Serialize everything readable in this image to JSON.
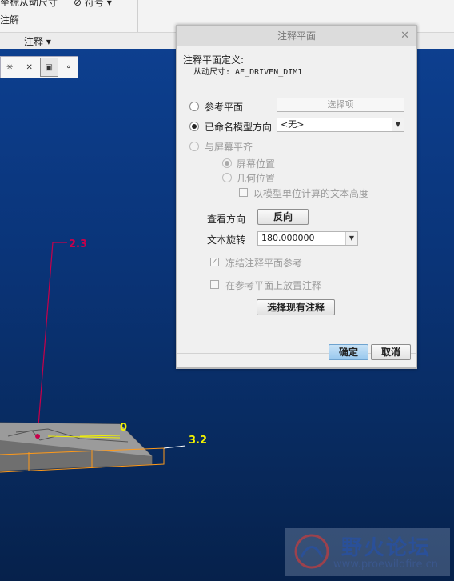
{
  "ribbon": {
    "row1_text": "坐标从动尺寸",
    "symbol_label": "符号",
    "row2_text": "注解",
    "group_label": "注释"
  },
  "dialog": {
    "title": "注释平面",
    "definition_label": "注释平面定义:",
    "driven_dim_label": "从动尺寸: AE_DRIVEN_DIM1",
    "ref_plane_label": "参考平面",
    "ref_plane_placeholder": "选择项",
    "named_view_label": "已命名模型方向",
    "named_view_value": "<无>",
    "align_screen_label": "与屏幕平齐",
    "screen_pos_label": "屏幕位置",
    "geom_pos_label": "几何位置",
    "model_units_label": "以模型单位计算的文本高度",
    "view_dir_label": "查看方向",
    "flip_button": "反向",
    "text_rotation_label": "文本旋转",
    "text_rotation_value": "180.000000",
    "freeze_label": "冻结注释平面参考",
    "place_on_ref_label": "在参考平面上放置注释",
    "select_existing_button": "选择现有注释",
    "ok_button": "确定",
    "cancel_button": "取消"
  },
  "model": {
    "dim_red": "2.3",
    "dim_zero": "0",
    "dim_yellow": "3.2"
  },
  "watermark": {
    "site_name": "野火论坛",
    "url": "www.proewildfire.cn"
  },
  "colors": {
    "accent_red": "#c8004a",
    "dim_yellow": "#f2f200",
    "edge_orange": "#ff9a1a"
  }
}
